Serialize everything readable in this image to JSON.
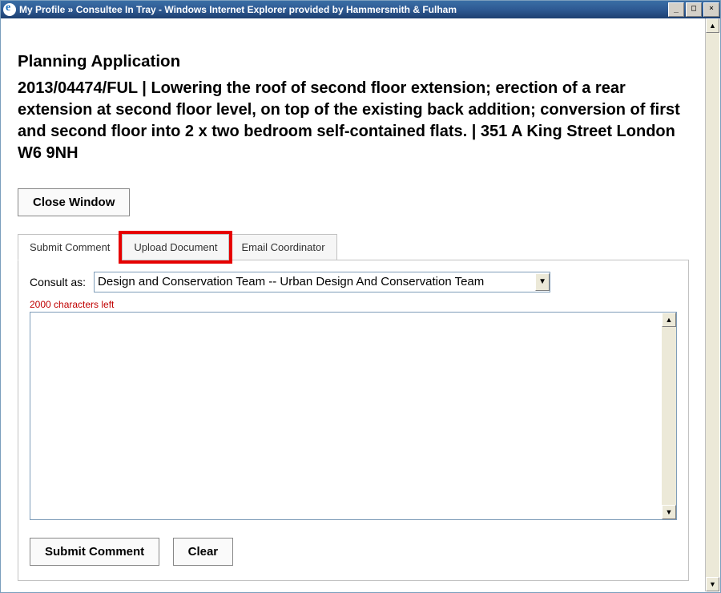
{
  "window": {
    "title": "My Profile » Consultee In Tray - Windows Internet Explorer provided by Hammersmith & Fulham"
  },
  "page": {
    "heading": "Planning Application",
    "detail": "2013/04474/FUL   |   Lowering the roof of second floor extension; erection of a rear extension at second floor level, on top of the existing back addition; conversion of first and second floor into 2 x two bedroom self-contained flats.   |    351 A King Street London W6 9NH"
  },
  "buttons": {
    "close_window": "Close Window",
    "submit_comment": "Submit Comment",
    "clear": "Clear"
  },
  "tabs": [
    {
      "label": "Submit Comment",
      "active": true
    },
    {
      "label": "Upload Document",
      "active": false,
      "highlighted": true
    },
    {
      "label": "Email Coordinator",
      "active": false
    }
  ],
  "form": {
    "consult_label": "Consult as:",
    "consult_selected": "Design and Conservation Team -- Urban Design And Conservation Team",
    "char_left": "2000 characters left",
    "comment_value": ""
  }
}
